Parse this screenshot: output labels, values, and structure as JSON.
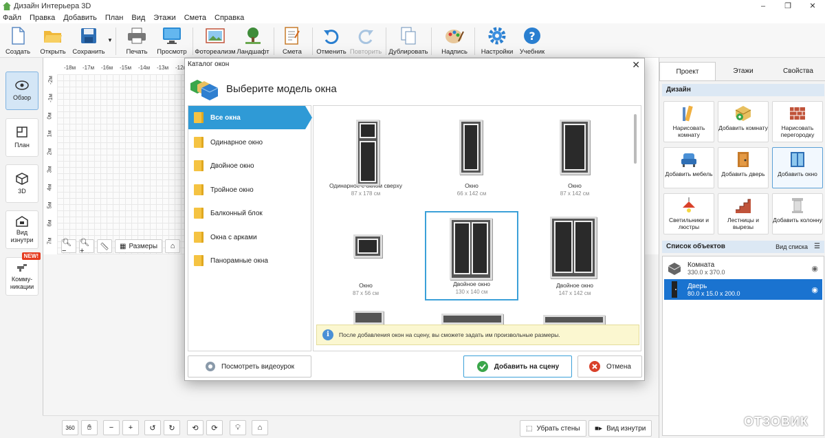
{
  "window": {
    "title": "Дизайн Интерьера 3D",
    "controls": [
      "–",
      "❐",
      "✕"
    ]
  },
  "menu": [
    "Файл",
    "Правка",
    "Добавить",
    "План",
    "Вид",
    "Этажи",
    "Смета",
    "Справка"
  ],
  "toolbar": {
    "create": "Создать",
    "open": "Открыть",
    "save": "Сохранить",
    "print": "Печать",
    "preview": "Просмотр",
    "photoreal": "Фотореализм",
    "landscape": "Ландшафт",
    "estimate": "Смета",
    "undo": "Отменить",
    "redo": "Повторить",
    "duplicate": "Дублировать",
    "labels": "Надпись",
    "settings": "Настройки",
    "tutorial": "Учебник"
  },
  "left_panel": {
    "overview": "Обзор",
    "plan": "План",
    "view3d": "3D",
    "inside": "Вид изнутри",
    "comms": "Комму-никации",
    "new_badge": "NEW!"
  },
  "ruler_top": [
    "-18м",
    "-17м",
    "-16м",
    "-15м",
    "-14м",
    "-13м",
    "-12м"
  ],
  "ruler_left": [
    "-2м",
    "-1м",
    "0м",
    "1м",
    "2м",
    "3м",
    "4м",
    "5м",
    "6м",
    "7м"
  ],
  "zoombar": {
    "sizes": "Размеры"
  },
  "bottombar": {
    "remove_walls": "Убрать стены",
    "inside_view": "Вид изнутри",
    "rotate360": "360"
  },
  "right_panel": {
    "tabs": [
      "Проект",
      "Этажи",
      "Свойства"
    ],
    "design_header": "Дизайн",
    "design_buttons": [
      "Нарисовать комнату",
      "Добавить комнату",
      "Нарисовать перегородку",
      "Добавить мебель",
      "Добавить дверь",
      "Добавить окно",
      "Светильники и люстры",
      "Лестницы и вырезы",
      "Добавить колонну"
    ],
    "objects_header": "Список объектов",
    "list_view": "Вид списка",
    "objects": [
      {
        "name": "Комната",
        "dims": "330.0 x 370.0"
      },
      {
        "name": "Дверь",
        "dims": "80.0 x 15.0 x 200.0"
      }
    ]
  },
  "dialog": {
    "title": "Каталог окон",
    "heading": "Выберите модель окна",
    "categories": [
      "Все окна",
      "Одинарное окно",
      "Двойное окно",
      "Тройное окно",
      "Балконный блок",
      "Окна с арками",
      "Панорамные окна"
    ],
    "items": [
      {
        "name": "Одинарное с окном сверху",
        "size": "87 x 178 см"
      },
      {
        "name": "Окно",
        "size": "66 x 142 см"
      },
      {
        "name": "Окно",
        "size": "87 x 142 см"
      },
      {
        "name": "Окно",
        "size": "87 x 56 см"
      },
      {
        "name": "Двойное окно",
        "size": "130 x 140 см"
      },
      {
        "name": "Двойное окно",
        "size": "147 x 142 см"
      }
    ],
    "info": "После добавления окон на сцену, вы сможете задать им произвольные размеры.",
    "video_button": "Посмотреть видеоурок",
    "add_button": "Добавить на сцену",
    "cancel_button": "Отмена"
  },
  "watermark": "ОТЗОВИК",
  "colors": {
    "accent": "#2f9ad6",
    "selection": "#1a73d0",
    "info_bg": "#fbf7d0"
  }
}
